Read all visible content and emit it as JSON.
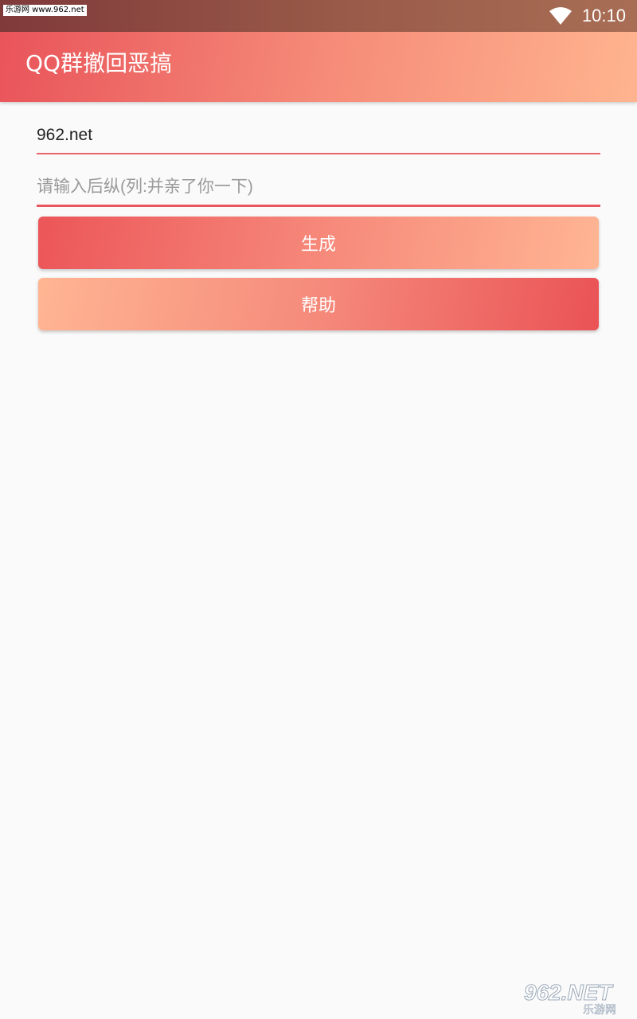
{
  "status_bar": {
    "watermark_tag": "乐游网 www.962.net",
    "time": "10:10",
    "wifi_icon": "wifi-icon"
  },
  "app_bar": {
    "title": "QQ群撤回恶搞"
  },
  "form": {
    "field_1_value": "962.net",
    "field_2_value": "",
    "field_2_placeholder": "请输入后纵(列:并亲了你一下)",
    "accent_color": "#e9545a"
  },
  "buttons": {
    "generate_label": "生成",
    "help_label": "帮助"
  },
  "logo": {
    "main_text": "962.NET",
    "sub_text": "乐游网"
  }
}
